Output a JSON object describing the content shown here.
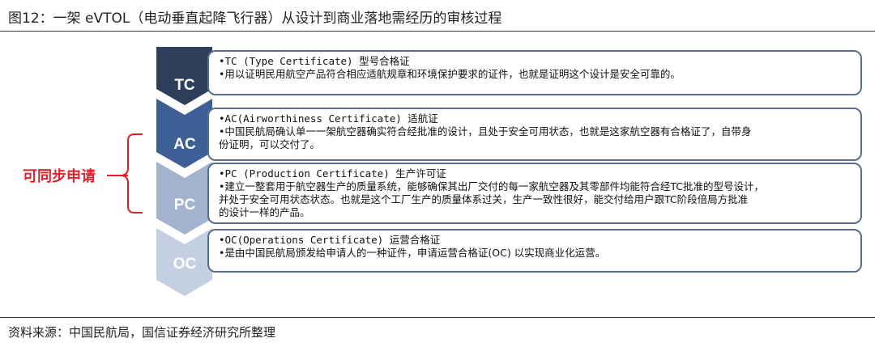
{
  "title": "图12：一架 eVTOL（电动垂直起降飞行器）从设计到商业落地需经历的审核过程",
  "source": "资料来源：中国民航局，国信证券经济研究所整理",
  "sync_label": "可同步申请",
  "colors": {
    "tc": "#2e3f5c",
    "ac": "#3d5f95",
    "pc": "#a3b3cf",
    "oc": "#c4cfe2",
    "accent": "#e0212b",
    "border": "#5a6e93"
  },
  "stages": [
    {
      "code": "TC",
      "heading": "•TC (Type Certificate) 型号合格证",
      "lines": [
        "•用以证明民用航空产品符合相应适航规章和环境保护要求的证件，也就是证明这个设计是安全可靠的。"
      ]
    },
    {
      "code": "AC",
      "heading": "•AC(Airworthiness Certificate) 适航证",
      "lines": [
        "•中国民航局确认单一一架航空器确实符合经批准的设计，且处于安全可用状态，也就是这家航空器有合格证了，自带身",
        "份证明，可以交付了。"
      ]
    },
    {
      "code": "PC",
      "heading": "•PC (Production Certificate) 生产许可证",
      "lines": [
        "•建立一整套用于航空器生产的质量系统，能够确保其出厂交付的每一家航空器及其零部件均能符合经TC批准的型号设计，",
        "并处于安全可用状态状态。也就是这个工厂生产的质量体系过关，生产一致性很好，能交付给用户跟TC阶段倍局方批准",
        "的设计一样的产品。"
      ]
    },
    {
      "code": "OC",
      "heading": "•OC(Operations  Certificate) 运营合格证",
      "lines": [
        "•是由中国民航局颁发给申请人的一种证件，申请运营合格证(OC) 以实现商业化运营。"
      ]
    }
  ]
}
